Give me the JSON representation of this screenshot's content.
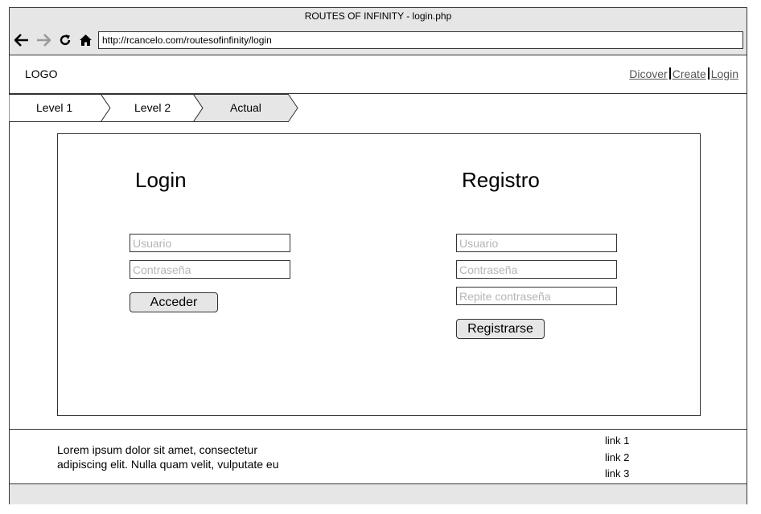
{
  "window": {
    "title": "ROUTES OF INFINITY - login.php"
  },
  "browser": {
    "url": "http://rcancelo.com/routesofinfinity/login",
    "icons": [
      "back-arrow-icon",
      "forward-arrow-icon",
      "reload-icon",
      "home-icon"
    ]
  },
  "header": {
    "logo": "LOGO",
    "links": [
      "Dicover",
      "Create",
      "Login"
    ]
  },
  "breadcrumb": [
    "Level 1",
    "Level 2",
    "Actual"
  ],
  "login": {
    "title": "Login",
    "username_placeholder": "Usuario",
    "password_placeholder": "Contraseña",
    "submit_label": "Acceder"
  },
  "register": {
    "title": "Registro",
    "username_placeholder": "Usuario",
    "password_placeholder": "Contraseña",
    "repeat_placeholder": "Repite contraseña",
    "submit_label": "Registrarse"
  },
  "footer": {
    "text": "Lorem ipsum dolor sit amet, consectetur adipiscing elit. Nulla quam velit, vulputate eu",
    "links": [
      "link 1",
      "link 2",
      "link 3"
    ]
  },
  "colors": {
    "chrome": "#e6e6e6",
    "border": "#333333",
    "link": "#555555",
    "placeholder": "#b5b5b5"
  }
}
